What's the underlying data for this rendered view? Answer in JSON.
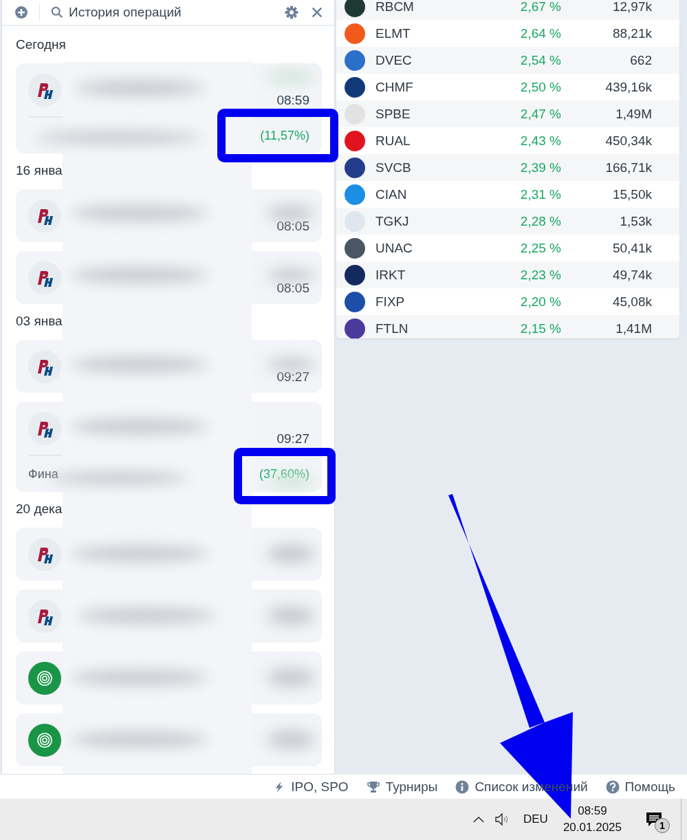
{
  "history_panel": {
    "title": "История операций",
    "sections": [
      {
        "date": "Сегодня",
        "cards": [
          {
            "kind": "ph",
            "time": "08:59",
            "percent": "(11,57%)"
          }
        ]
      },
      {
        "date": "16 янва",
        "cards": [
          {
            "kind": "ph",
            "time": "08:05"
          },
          {
            "kind": "ph",
            "time": "08:05"
          }
        ]
      },
      {
        "date": "03 янва",
        "cards": [
          {
            "kind": "ph",
            "time": "09:27"
          },
          {
            "kind": "ph",
            "time": "09:27",
            "sub_label": "Фина",
            "percent": "(37,60%)"
          }
        ]
      },
      {
        "date": "20 дека",
        "cards": [
          {
            "kind": "ph"
          },
          {
            "kind": "ph"
          },
          {
            "kind": "spiral"
          },
          {
            "kind": "spiral"
          }
        ]
      }
    ]
  },
  "quotes": [
    {
      "ticker": "RBCM",
      "change": "2,67 %",
      "volume": "12,97k",
      "color": "#1f3a34"
    },
    {
      "ticker": "ELMT",
      "change": "2,64 %",
      "volume": "88,21k",
      "color": "#f25a1c"
    },
    {
      "ticker": "DVEC",
      "change": "2,54 %",
      "volume": "662",
      "color": "#2a6fc9"
    },
    {
      "ticker": "CHMF",
      "change": "2,50 %",
      "volume": "439,16k",
      "color": "#123a7a"
    },
    {
      "ticker": "SPBE",
      "change": "2,47 %",
      "volume": "1,49M",
      "color": "#e2e2e2"
    },
    {
      "ticker": "RUAL",
      "change": "2,43 %",
      "volume": "450,34k",
      "color": "#e0141e"
    },
    {
      "ticker": "SVCB",
      "change": "2,39 %",
      "volume": "166,71k",
      "color": "#233c8c"
    },
    {
      "ticker": "CIAN",
      "change": "2,31 %",
      "volume": "15,50k",
      "color": "#1a8fe3"
    },
    {
      "ticker": "TGKJ",
      "change": "2,28 %",
      "volume": "1,53k",
      "color": "#dfe6ee"
    },
    {
      "ticker": "UNAC",
      "change": "2,25 %",
      "volume": "50,41k",
      "color": "#4a5663"
    },
    {
      "ticker": "IRKT",
      "change": "2,23 %",
      "volume": "49,74k",
      "color": "#14295e"
    },
    {
      "ticker": "FIXP",
      "change": "2,20 %",
      "volume": "45,08k",
      "color": "#1d4fa8"
    },
    {
      "ticker": "FTLN",
      "change": "2,15 %",
      "volume": "1,41M",
      "color": "#4b3a9c"
    }
  ],
  "footer_links": [
    {
      "kind": "bolt",
      "label": "IPO, SPO"
    },
    {
      "kind": "trophy",
      "label": "Турниры"
    },
    {
      "kind": "info",
      "label": "Список изменений"
    },
    {
      "kind": "help",
      "label": "Помощь"
    }
  ],
  "taskbar": {
    "language": "DEU",
    "time": "08:59",
    "date": "20.01.2025",
    "notifications": "1"
  }
}
